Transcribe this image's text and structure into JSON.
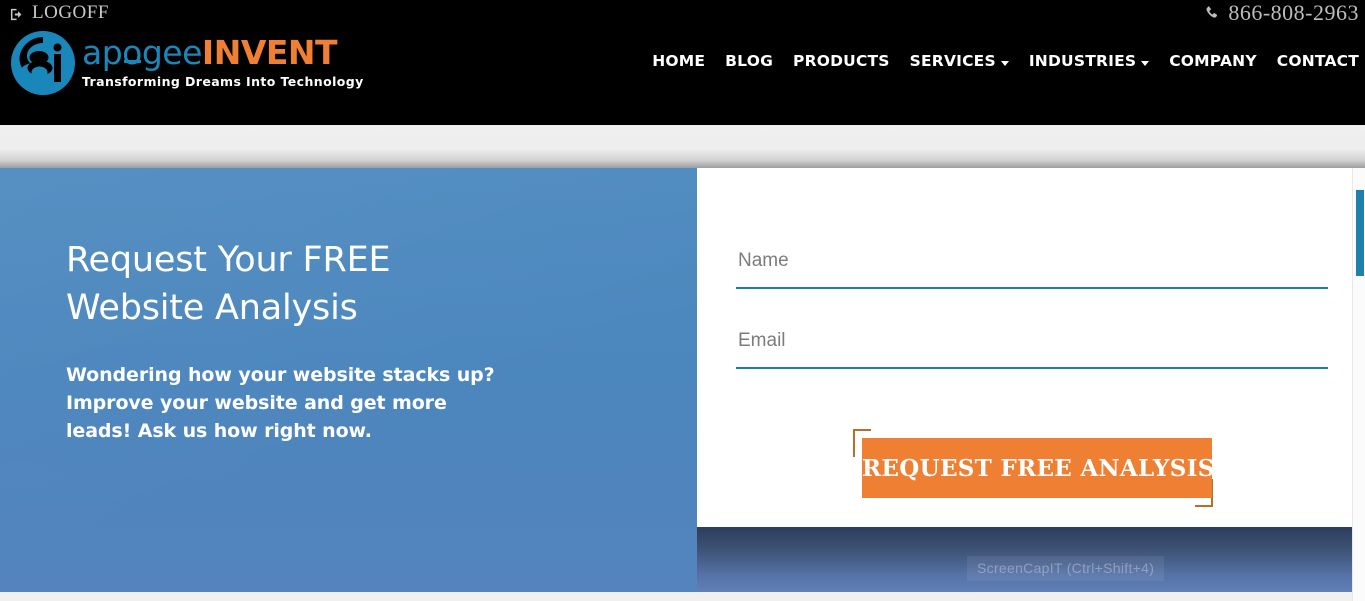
{
  "topbar": {
    "logoff_label": "LOGOFF",
    "logoff_icon": "sign-out-icon",
    "phone_number": "866-808-2963",
    "phone_icon": "phone-handset-icon"
  },
  "brand": {
    "name_part1": "apogee",
    "name_part2": "INVENT",
    "tagline": "Transforming Dreams Into Technology",
    "logo_icon": "apogee-ai-circle-logo",
    "color_blue": "#1a87bb",
    "color_orange": "#ef7f33"
  },
  "nav": {
    "items": [
      {
        "label": "HOME",
        "has_dropdown": false
      },
      {
        "label": "BLOG",
        "has_dropdown": false
      },
      {
        "label": "PRODUCTS",
        "has_dropdown": false
      },
      {
        "label": "SERVICES",
        "has_dropdown": true
      },
      {
        "label": "INDUSTRIES",
        "has_dropdown": true
      },
      {
        "label": "COMPANY",
        "has_dropdown": false
      },
      {
        "label": "CONTACT",
        "has_dropdown": false
      }
    ]
  },
  "hero": {
    "title_line1": "Request Your FREE",
    "title_line2": "Website Analysis",
    "sub_line1": "Wondering how your website stacks up?",
    "sub_line2": "Improve your website and get more",
    "sub_line3": "leads! Ask us how right now.",
    "background_color": "#4b86bd"
  },
  "form": {
    "name_field": {
      "value": "",
      "placeholder": "Name"
    },
    "email_field": {
      "value": "",
      "placeholder": "Email"
    },
    "submit_label": "REQUEST FREE ANALYSIS",
    "submit_color": "#ef7f33",
    "underline_color": "#1b7ca5"
  },
  "overlay": {
    "screencap_hint": "ScreenCapIT  (Ctrl+Shift+4)"
  },
  "scrollbar": {
    "thumb_color": "#1f7fad"
  }
}
